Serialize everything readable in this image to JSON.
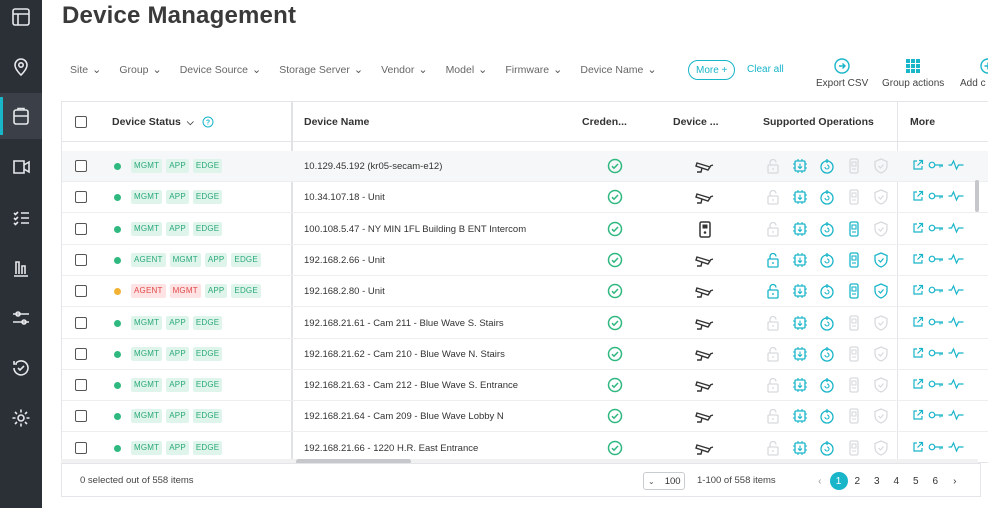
{
  "page": {
    "title": "Device Management"
  },
  "nav": {
    "items": [
      "layout-icon",
      "map-pin-icon",
      "clipboard-icon",
      "camera-icon",
      "checklist-icon",
      "bar-chart-icon",
      "sliders-icon",
      "history-icon",
      "settings-icon"
    ],
    "active_index": 2
  },
  "filters": [
    "Site",
    "Group",
    "Device Source",
    "Storage Server",
    "Vendor",
    "Model",
    "Firmware",
    "Device Name"
  ],
  "filter_more": "More +",
  "clear_all": "Clear all",
  "actions": {
    "export": "Export CSV",
    "group": "Group actions",
    "add": "Add c"
  },
  "columns": {
    "status": "Device Status",
    "name": "Device Name",
    "cred": "Creden...",
    "device": "Device ...",
    "ops": "Supported Operations",
    "more": "More"
  },
  "colors": {
    "accent": "#19b5c9",
    "ok": "#2fb87f",
    "warn": "#f2b233",
    "rail": "#2b2f36"
  },
  "rows": [
    {
      "status": "ok",
      "tags": [
        [
          "MGMT",
          "g"
        ],
        [
          "APP",
          "g"
        ],
        [
          "EDGE",
          "g"
        ]
      ],
      "name": "10.129.45.192 (kr05-secam-e12)",
      "device": "camera",
      "ops_full": false
    },
    {
      "status": "ok",
      "tags": [
        [
          "MGMT",
          "g"
        ],
        [
          "APP",
          "g"
        ],
        [
          "EDGE",
          "g"
        ]
      ],
      "name": "10.34.107.18 - Unit",
      "device": "camera",
      "ops_full": false
    },
    {
      "status": "ok",
      "tags": [
        [
          "MGMT",
          "g"
        ],
        [
          "APP",
          "g"
        ],
        [
          "EDGE",
          "g"
        ]
      ],
      "name": "100.108.5.47 - NY MIN 1FL Building B ENT Intercom",
      "device": "intercom",
      "ops_full": "partial"
    },
    {
      "status": "ok",
      "tags": [
        [
          "AGENT",
          "g"
        ],
        [
          "MGMT",
          "g"
        ],
        [
          "APP",
          "g"
        ],
        [
          "EDGE",
          "g"
        ]
      ],
      "name": "192.168.2.66 - Unit",
      "device": "camera",
      "ops_full": true
    },
    {
      "status": "warn",
      "tags": [
        [
          "AGENT",
          "r"
        ],
        [
          "MGMT",
          "r"
        ],
        [
          "APP",
          "g"
        ],
        [
          "EDGE",
          "g"
        ]
      ],
      "name": "192.168.2.80 - Unit",
      "device": "camera",
      "ops_full": true
    },
    {
      "status": "ok",
      "tags": [
        [
          "MGMT",
          "g"
        ],
        [
          "APP",
          "g"
        ],
        [
          "EDGE",
          "g"
        ]
      ],
      "name": "192.168.21.61 - Cam 211 - Blue Wave S. Stairs",
      "device": "camera",
      "ops_full": false
    },
    {
      "status": "ok",
      "tags": [
        [
          "MGMT",
          "g"
        ],
        [
          "APP",
          "g"
        ],
        [
          "EDGE",
          "g"
        ]
      ],
      "name": "192.168.21.62 - Cam 210 - Blue Wave N. Stairs",
      "device": "camera",
      "ops_full": false
    },
    {
      "status": "ok",
      "tags": [
        [
          "MGMT",
          "g"
        ],
        [
          "APP",
          "g"
        ],
        [
          "EDGE",
          "g"
        ]
      ],
      "name": "192.168.21.63 - Cam 212 - Blue Wave S. Entrance",
      "device": "camera",
      "ops_full": false
    },
    {
      "status": "ok",
      "tags": [
        [
          "MGMT",
          "g"
        ],
        [
          "APP",
          "g"
        ],
        [
          "EDGE",
          "g"
        ]
      ],
      "name": "192.168.21.64 - Cam 209 - Blue Wave Lobby N",
      "device": "camera",
      "ops_full": false
    },
    {
      "status": "ok",
      "tags": [
        [
          "MGMT",
          "g"
        ],
        [
          "APP",
          "g"
        ],
        [
          "EDGE",
          "g"
        ]
      ],
      "name": "192.168.21.66 - 1220 H.R. East Entrance",
      "device": "camera",
      "ops_full": false
    }
  ],
  "footer": {
    "selected": "0 selected out of 558 items",
    "page_size": "100",
    "range": "1-100 of 558 items",
    "pages": [
      "1",
      "2",
      "3",
      "4",
      "5",
      "6"
    ],
    "current_page": "1"
  }
}
